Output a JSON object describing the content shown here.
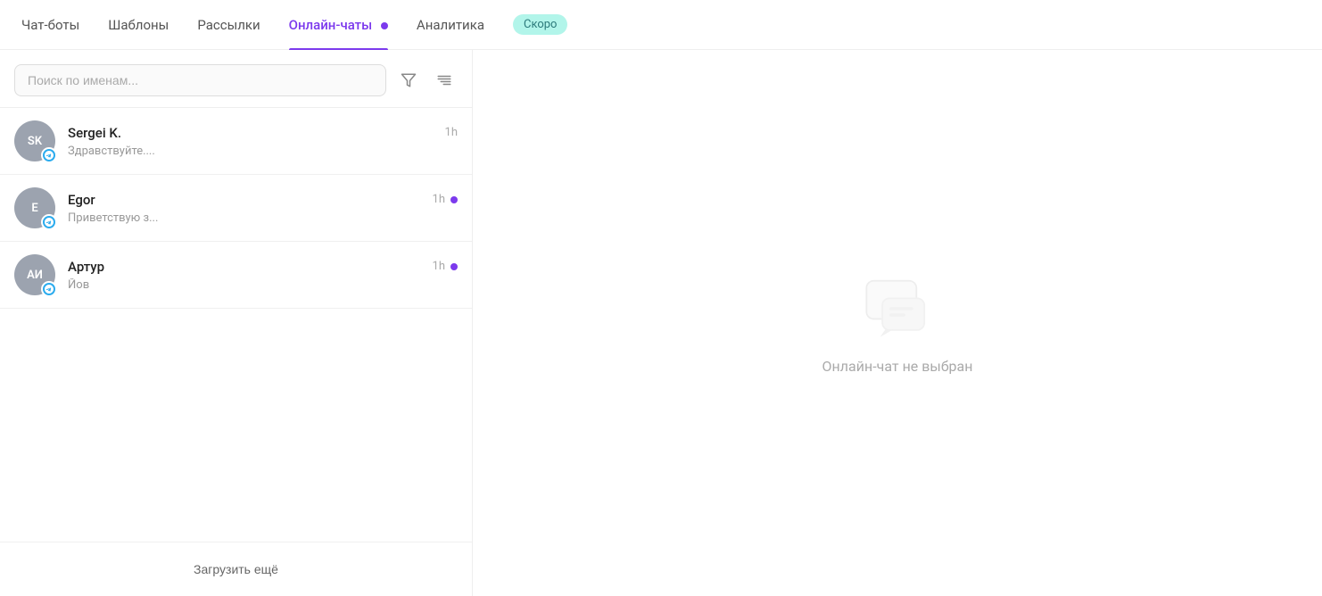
{
  "nav": {
    "items": [
      {
        "id": "chatbots",
        "label": "Чат-боты",
        "active": false,
        "badge": false
      },
      {
        "id": "templates",
        "label": "Шаблоны",
        "active": false,
        "badge": false
      },
      {
        "id": "broadcasts",
        "label": "Рассылки",
        "active": false,
        "badge": false
      },
      {
        "id": "online-chat",
        "label": "Онлайн-чаты",
        "active": true,
        "badge": true
      },
      {
        "id": "analytics",
        "label": "Аналитика",
        "active": false,
        "badge": false
      },
      {
        "id": "soon",
        "label": "Скоро",
        "active": false,
        "badge": false,
        "special": true
      }
    ]
  },
  "search": {
    "placeholder": "Поиск по именам..."
  },
  "chats": [
    {
      "id": "sk",
      "initials": "SK",
      "name": "Sergei K.",
      "preview": "Здравствуйте....",
      "time": "1h",
      "unread": false
    },
    {
      "id": "e",
      "initials": "E",
      "name": "Egor",
      "preview": "Приветствую з...",
      "time": "1h",
      "unread": true
    },
    {
      "id": "ai",
      "initials": "АИ",
      "name": "Артур",
      "preview": "Йов",
      "time": "1h",
      "unread": true
    }
  ],
  "load_more_label": "Загрузить ещё",
  "empty_state": {
    "text": "Онлайн-чат не выбран"
  }
}
